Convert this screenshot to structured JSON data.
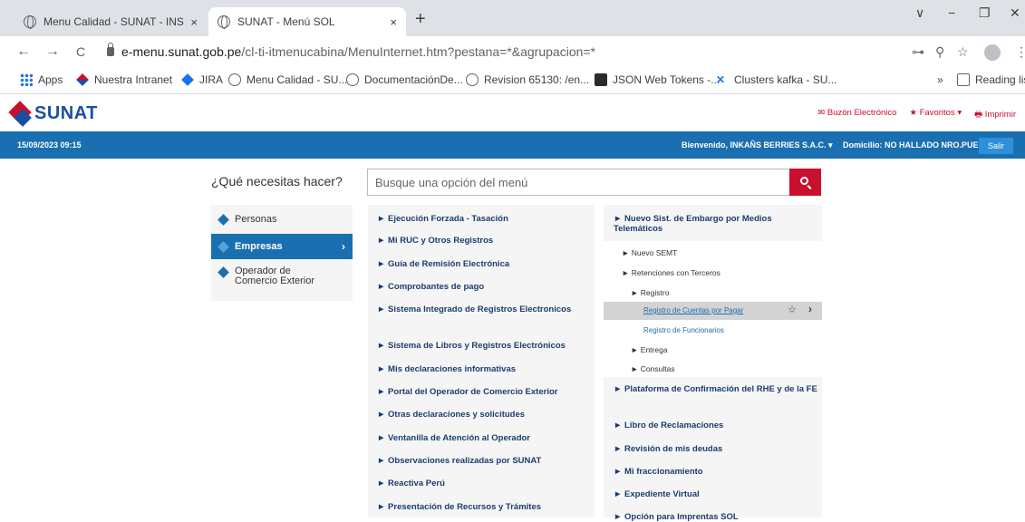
{
  "browser": {
    "tabs": [
      {
        "title": "Menu Calidad - SUNAT - INSI",
        "close": "×"
      },
      {
        "title": "SUNAT - Menú SOL",
        "close": "×"
      }
    ],
    "new_tab": "+",
    "window_controls": {
      "minimize": "−",
      "restore": "❐",
      "close": "✕",
      "tab_list": "∨"
    },
    "nav": {
      "back": "←",
      "forward": "→",
      "reload": "C"
    },
    "url_host": "e-menu.sunat.gob.pe",
    "url_path": "/cl-ti-itmenucabina/MenuInternet.htm?pestana=*&agrupacion=*",
    "toolbar_icons": {
      "key": "⊶",
      "zoom": "⚲",
      "star": "☆",
      "extensions": "✱",
      "more": "⋮"
    },
    "bookmarks": [
      {
        "label": "Apps",
        "icon": "apps-icon"
      },
      {
        "label": "Nuestra Intranet",
        "icon": "sunat-diamond-icon"
      },
      {
        "label": "JIRA",
        "icon": "jira-icon"
      },
      {
        "label": "Menu Calidad - SU...",
        "icon": "globe-icon"
      },
      {
        "label": "DocumentaciónDe...",
        "icon": "globe-icon"
      },
      {
        "label": "Revision 65130: /en...",
        "icon": "globe-icon"
      },
      {
        "label": "JSON Web Tokens -...",
        "icon": "jwt-icon"
      },
      {
        "label": "Clusters kafka - SU...",
        "icon": "x-icon"
      }
    ],
    "bookmarks_overflow": "»",
    "reading_list": "Reading list"
  },
  "header": {
    "logo_text": "SUNAT",
    "links": {
      "buzon": "✉ Buzón Electrónico",
      "favoritos": "★ Favoritos ▾",
      "imprimir": "🖶 Imprimir"
    }
  },
  "bluebar": {
    "datetime": "15/09/2023 09:15",
    "welcome": "Bienvenido, INKAÑS BERRIES S.A.C. ▾",
    "address": "Domicilio: NO HALLADO NRO.PUERTA",
    "salir": "Salir"
  },
  "search": {
    "question": "¿Qué necesitas hacer?",
    "placeholder": "Busque una opción del menú"
  },
  "left_menu": {
    "items": [
      {
        "label": "Personas"
      },
      {
        "label": "Empresas",
        "chevron": "›"
      },
      {
        "label_1": "Operador de",
        "label_2": "Comercio Exterior"
      }
    ]
  },
  "middle_menu": {
    "items": [
      "► Ejecución Forzada - Tasación",
      "► Mi RUC y Otros Registros",
      "► Guía de Remisión Electrónica",
      "► Comprobantes de pago",
      "► Sistema Integrado de Registros Electronicos",
      "► Sistema de Libros y Registros Electrónicos",
      "► Mis declaraciones informativas",
      "► Portal del Operador de Comercio Exterior",
      "► Otras declaraciones y solicitudes",
      "► Ventanilla de Atención al Operador",
      "► Observaciones realizadas por SUNAT",
      "► Reactiva Perú",
      "► Presentación de Recursos y Trámites"
    ]
  },
  "right_menu": {
    "title": "► Nuevo Sist. de Embargo por Medios Telemáticos",
    "nuevo_semt": "► Nuevo SEMT",
    "retenciones": "► Retenciones con Terceros",
    "registro": "► Registro",
    "selected": {
      "label": "Registro de Cuentas por Pagar",
      "star": "☆",
      "chevron": "›"
    },
    "registro_funcionarios": "Registro de Funcionarios",
    "entrega": "► Entrega",
    "consultas": "► Consultas",
    "items": [
      "► Plataforma de Confirmación del RHE y de la FE",
      "► Libro de Reclamaciones",
      "► Revisión de mis deudas",
      "► Mi fraccionamiento",
      "► Expediente Virtual",
      "► Opción para Imprentas SOL"
    ]
  },
  "colors": {
    "sunat_blue": "#1a6fb0",
    "sunat_red": "#c8102e",
    "link_blue": "#1a3d6d"
  }
}
